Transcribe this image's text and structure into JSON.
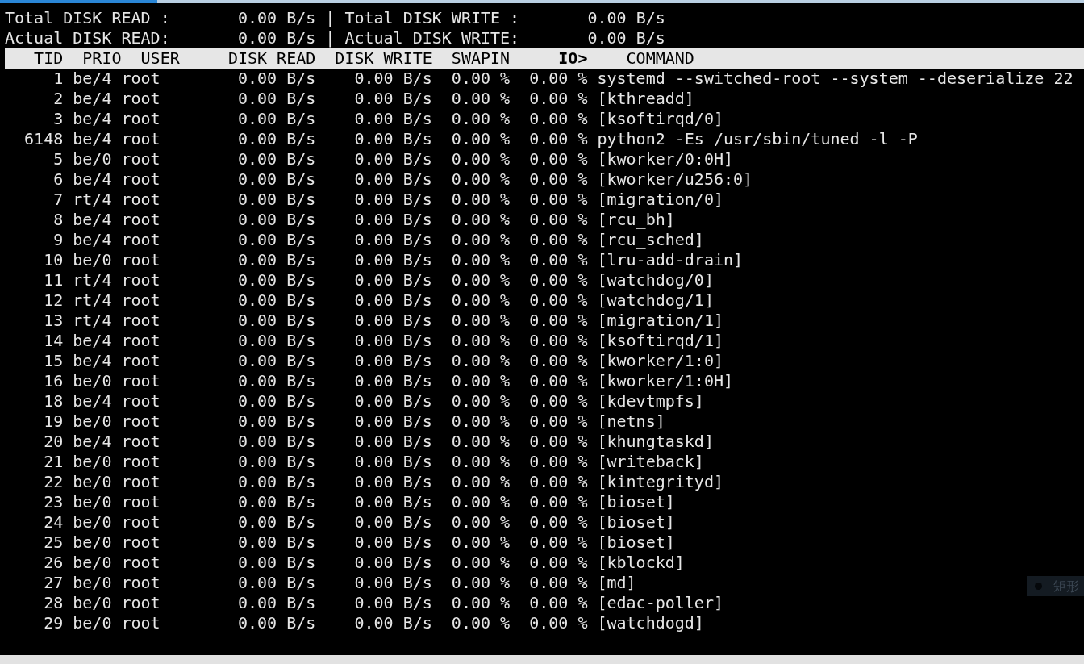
{
  "summary_lines": [
    {
      "read_label": "Total DISK READ :",
      "read_value": "0.00 B/s",
      "separator": "|",
      "write_label": "Total DISK WRITE :",
      "write_value": "0.00 B/s"
    },
    {
      "read_label": "Actual DISK READ:",
      "read_value": "0.00 B/s",
      "separator": "|",
      "write_label": "Actual DISK WRITE:",
      "write_value": "0.00 B/s"
    }
  ],
  "table": {
    "columns": [
      {
        "label": "TID",
        "sorted": false
      },
      {
        "label": "PRIO",
        "sorted": false
      },
      {
        "label": "USER",
        "sorted": false
      },
      {
        "label": "DISK READ",
        "sorted": false
      },
      {
        "label": "DISK WRITE",
        "sorted": false
      },
      {
        "label": "SWAPIN",
        "sorted": false
      },
      {
        "label": "IO>",
        "sorted": true
      },
      {
        "label": "COMMAND",
        "sorted": false
      }
    ],
    "rows": [
      {
        "tid": "1",
        "prio": "be/4",
        "user": "root",
        "disk_read": "0.00 B/s",
        "disk_write": "0.00 B/s",
        "swapin": "0.00 %",
        "io": "0.00 %",
        "command": "systemd --switched-root --system --deserialize 22"
      },
      {
        "tid": "2",
        "prio": "be/4",
        "user": "root",
        "disk_read": "0.00 B/s",
        "disk_write": "0.00 B/s",
        "swapin": "0.00 %",
        "io": "0.00 %",
        "command": "[kthreadd]"
      },
      {
        "tid": "3",
        "prio": "be/4",
        "user": "root",
        "disk_read": "0.00 B/s",
        "disk_write": "0.00 B/s",
        "swapin": "0.00 %",
        "io": "0.00 %",
        "command": "[ksoftirqd/0]"
      },
      {
        "tid": "6148",
        "prio": "be/4",
        "user": "root",
        "disk_read": "0.00 B/s",
        "disk_write": "0.00 B/s",
        "swapin": "0.00 %",
        "io": "0.00 %",
        "command": "python2 -Es /usr/sbin/tuned -l -P"
      },
      {
        "tid": "5",
        "prio": "be/0",
        "user": "root",
        "disk_read": "0.00 B/s",
        "disk_write": "0.00 B/s",
        "swapin": "0.00 %",
        "io": "0.00 %",
        "command": "[kworker/0:0H]"
      },
      {
        "tid": "6",
        "prio": "be/4",
        "user": "root",
        "disk_read": "0.00 B/s",
        "disk_write": "0.00 B/s",
        "swapin": "0.00 %",
        "io": "0.00 %",
        "command": "[kworker/u256:0]"
      },
      {
        "tid": "7",
        "prio": "rt/4",
        "user": "root",
        "disk_read": "0.00 B/s",
        "disk_write": "0.00 B/s",
        "swapin": "0.00 %",
        "io": "0.00 %",
        "command": "[migration/0]"
      },
      {
        "tid": "8",
        "prio": "be/4",
        "user": "root",
        "disk_read": "0.00 B/s",
        "disk_write": "0.00 B/s",
        "swapin": "0.00 %",
        "io": "0.00 %",
        "command": "[rcu_bh]"
      },
      {
        "tid": "9",
        "prio": "be/4",
        "user": "root",
        "disk_read": "0.00 B/s",
        "disk_write": "0.00 B/s",
        "swapin": "0.00 %",
        "io": "0.00 %",
        "command": "[rcu_sched]"
      },
      {
        "tid": "10",
        "prio": "be/0",
        "user": "root",
        "disk_read": "0.00 B/s",
        "disk_write": "0.00 B/s",
        "swapin": "0.00 %",
        "io": "0.00 %",
        "command": "[lru-add-drain]"
      },
      {
        "tid": "11",
        "prio": "rt/4",
        "user": "root",
        "disk_read": "0.00 B/s",
        "disk_write": "0.00 B/s",
        "swapin": "0.00 %",
        "io": "0.00 %",
        "command": "[watchdog/0]"
      },
      {
        "tid": "12",
        "prio": "rt/4",
        "user": "root",
        "disk_read": "0.00 B/s",
        "disk_write": "0.00 B/s",
        "swapin": "0.00 %",
        "io": "0.00 %",
        "command": "[watchdog/1]"
      },
      {
        "tid": "13",
        "prio": "rt/4",
        "user": "root",
        "disk_read": "0.00 B/s",
        "disk_write": "0.00 B/s",
        "swapin": "0.00 %",
        "io": "0.00 %",
        "command": "[migration/1]"
      },
      {
        "tid": "14",
        "prio": "be/4",
        "user": "root",
        "disk_read": "0.00 B/s",
        "disk_write": "0.00 B/s",
        "swapin": "0.00 %",
        "io": "0.00 %",
        "command": "[ksoftirqd/1]"
      },
      {
        "tid": "15",
        "prio": "be/4",
        "user": "root",
        "disk_read": "0.00 B/s",
        "disk_write": "0.00 B/s",
        "swapin": "0.00 %",
        "io": "0.00 %",
        "command": "[kworker/1:0]"
      },
      {
        "tid": "16",
        "prio": "be/0",
        "user": "root",
        "disk_read": "0.00 B/s",
        "disk_write": "0.00 B/s",
        "swapin": "0.00 %",
        "io": "0.00 %",
        "command": "[kworker/1:0H]"
      },
      {
        "tid": "18",
        "prio": "be/4",
        "user": "root",
        "disk_read": "0.00 B/s",
        "disk_write": "0.00 B/s",
        "swapin": "0.00 %",
        "io": "0.00 %",
        "command": "[kdevtmpfs]"
      },
      {
        "tid": "19",
        "prio": "be/0",
        "user": "root",
        "disk_read": "0.00 B/s",
        "disk_write": "0.00 B/s",
        "swapin": "0.00 %",
        "io": "0.00 %",
        "command": "[netns]"
      },
      {
        "tid": "20",
        "prio": "be/4",
        "user": "root",
        "disk_read": "0.00 B/s",
        "disk_write": "0.00 B/s",
        "swapin": "0.00 %",
        "io": "0.00 %",
        "command": "[khungtaskd]"
      },
      {
        "tid": "21",
        "prio": "be/0",
        "user": "root",
        "disk_read": "0.00 B/s",
        "disk_write": "0.00 B/s",
        "swapin": "0.00 %",
        "io": "0.00 %",
        "command": "[writeback]"
      },
      {
        "tid": "22",
        "prio": "be/0",
        "user": "root",
        "disk_read": "0.00 B/s",
        "disk_write": "0.00 B/s",
        "swapin": "0.00 %",
        "io": "0.00 %",
        "command": "[kintegrityd]"
      },
      {
        "tid": "23",
        "prio": "be/0",
        "user": "root",
        "disk_read": "0.00 B/s",
        "disk_write": "0.00 B/s",
        "swapin": "0.00 %",
        "io": "0.00 %",
        "command": "[bioset]"
      },
      {
        "tid": "24",
        "prio": "be/0",
        "user": "root",
        "disk_read": "0.00 B/s",
        "disk_write": "0.00 B/s",
        "swapin": "0.00 %",
        "io": "0.00 %",
        "command": "[bioset]"
      },
      {
        "tid": "25",
        "prio": "be/0",
        "user": "root",
        "disk_read": "0.00 B/s",
        "disk_write": "0.00 B/s",
        "swapin": "0.00 %",
        "io": "0.00 %",
        "command": "[bioset]"
      },
      {
        "tid": "26",
        "prio": "be/0",
        "user": "root",
        "disk_read": "0.00 B/s",
        "disk_write": "0.00 B/s",
        "swapin": "0.00 %",
        "io": "0.00 %",
        "command": "[kblockd]"
      },
      {
        "tid": "27",
        "prio": "be/0",
        "user": "root",
        "disk_read": "0.00 B/s",
        "disk_write": "0.00 B/s",
        "swapin": "0.00 %",
        "io": "0.00 %",
        "command": "[md]"
      },
      {
        "tid": "28",
        "prio": "be/0",
        "user": "root",
        "disk_read": "0.00 B/s",
        "disk_write": "0.00 B/s",
        "swapin": "0.00 %",
        "io": "0.00 %",
        "command": "[edac-poller]"
      },
      {
        "tid": "29",
        "prio": "be/0",
        "user": "root",
        "disk_read": "0.00 B/s",
        "disk_write": "0.00 B/s",
        "swapin": "0.00 %",
        "io": "0.00 %",
        "command": "[watchdogd]"
      }
    ]
  },
  "tooltip": {
    "text": "矩形"
  }
}
